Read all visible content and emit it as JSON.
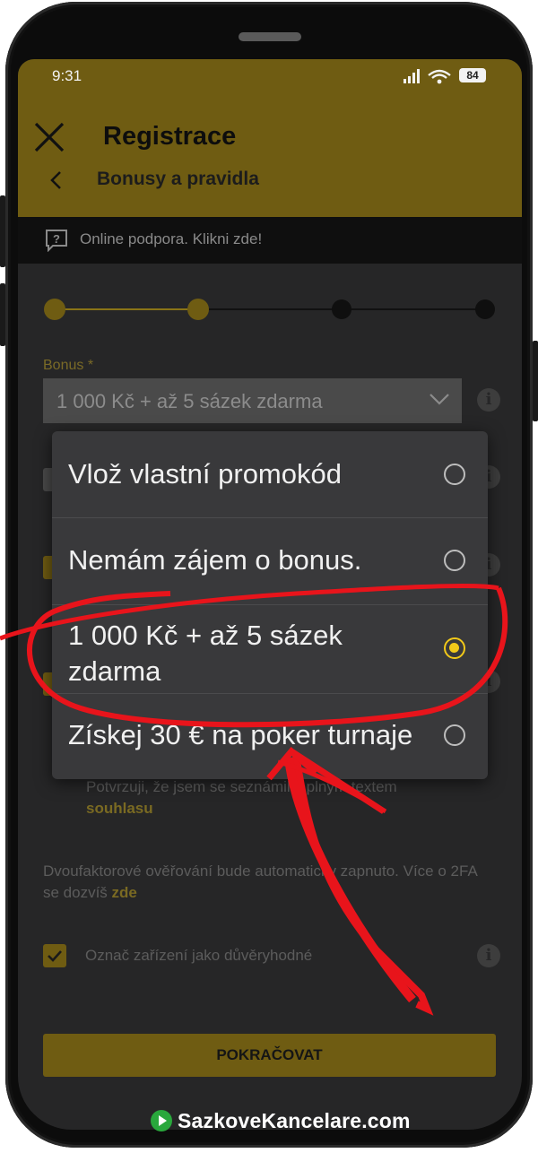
{
  "status_bar": {
    "time": "9:31",
    "battery": "84"
  },
  "header": {
    "title": "Registrace",
    "subtitle": "Bonusy a pravidla"
  },
  "support": {
    "text": "Online podpora. Klikni zde!"
  },
  "stepper": {
    "total_steps": 4,
    "completed_steps": 2
  },
  "bonus": {
    "label": "Bonus *",
    "selected_value": "1 000 Kč + až 5 sázek zdarma"
  },
  "dropdown_options": [
    {
      "label": "Vlož vlastní promokód",
      "selected": false
    },
    {
      "label": "Nemám zájem o bonus.",
      "selected": false
    },
    {
      "label": "1 000 Kč + až 5 sázek zdarma",
      "selected": true
    },
    {
      "label": "Získej 30 € na poker turnaje",
      "selected": false
    }
  ],
  "consent": {
    "text": "Potvrzuji, že jsem se seznámil s plným textem",
    "link": "souhlasu"
  },
  "twofa": {
    "text": "Dvoufaktorové ověřování bude automaticky zapnuto. Více o 2FA se dozvíš",
    "link": "zde"
  },
  "trusted_device": {
    "label": "Označ zařízení jako důvěryhodné",
    "checked": true
  },
  "continue_button": {
    "label": "POKRAČOVAT"
  },
  "watermark": {
    "text": "SazkoveKancelare.com"
  },
  "colors": {
    "accent": "#f2c919",
    "header": "#6f5c12",
    "annotation": "#e8141b"
  }
}
